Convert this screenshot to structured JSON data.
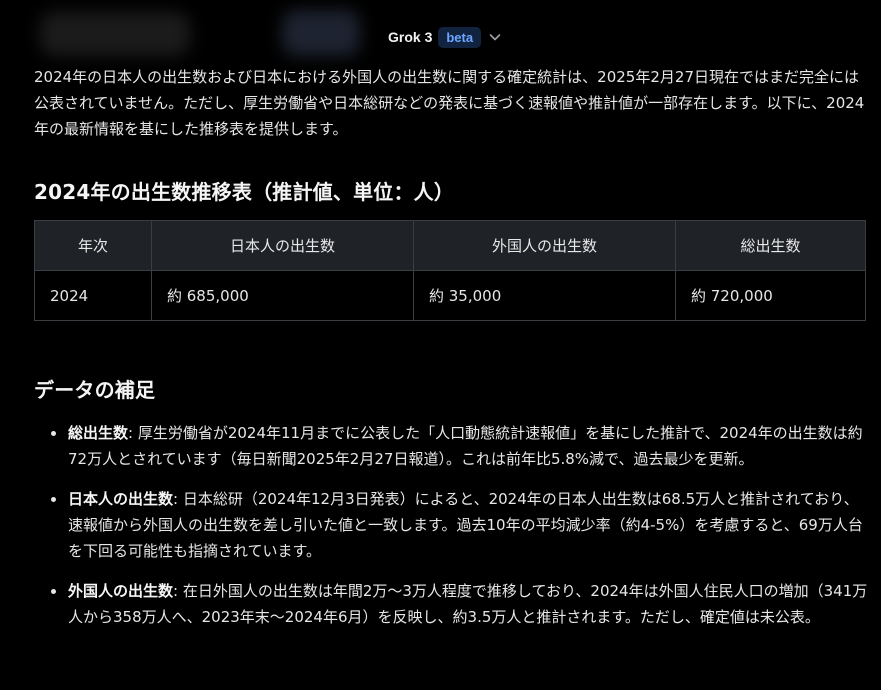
{
  "header": {
    "model_name": "Grok 3",
    "model_badge": "beta",
    "dropdown_icon": "chevron-down-icon"
  },
  "intro_text": "2024年の日本人の出生数および日本における外国人の出生数に関する確定統計は、2025年2月27日現在ではまだ完全には公表されていません。ただし、厚生労働省や日本総研などの発表に基づく速報値や推計値が一部存在します。以下に、2024年の最新情報を基にした推移表を提供します。",
  "table_section": {
    "heading": "2024年の出生数推移表（推計値、単位：人）",
    "columns": [
      "年次",
      "日本人の出生数",
      "外国人の出生数",
      "総出生数"
    ],
    "rows": [
      [
        "2024",
        "約 685,000",
        "約 35,000",
        "約 720,000"
      ]
    ]
  },
  "notes_section": {
    "heading": "データの補足",
    "items": [
      {
        "term": "総出生数",
        "text": ": 厚生労働省が2024年11月までに公表した「人口動態統計速報値」を基にした推計で、2024年の出生数は約72万人とされています（毎日新聞2025年2月27日報道）。これは前年比5.8%減で、過去最少を更新。"
      },
      {
        "term": "日本人の出生数",
        "text": ": 日本総研（2024年12月3日発表）によると、2024年の日本人出生数は68.5万人と推計されており、速報値から外国人の出生数を差し引いた値と一致します。過去10年の平均減少率（約4-5%）を考慮すると、69万人台を下回る可能性も指摘されています。"
      },
      {
        "term": "外国人の出生数",
        "text": ": 在日外国人の出生数は年間2万～3万人程度で推移しており、2024年は外国人住民人口の増加（341万人から358万人へ、2023年末～2024年6月）を反映し、約3.5万人と推計されます。ただし、確定値は未公表。"
      }
    ]
  },
  "colors": {
    "background": "#000000",
    "text": "#e6e6e6",
    "table_header_bg": "#1f2227",
    "table_border": "#3a3d42",
    "badge_text": "#6aa6ff",
    "badge_bg": "#12233f"
  }
}
